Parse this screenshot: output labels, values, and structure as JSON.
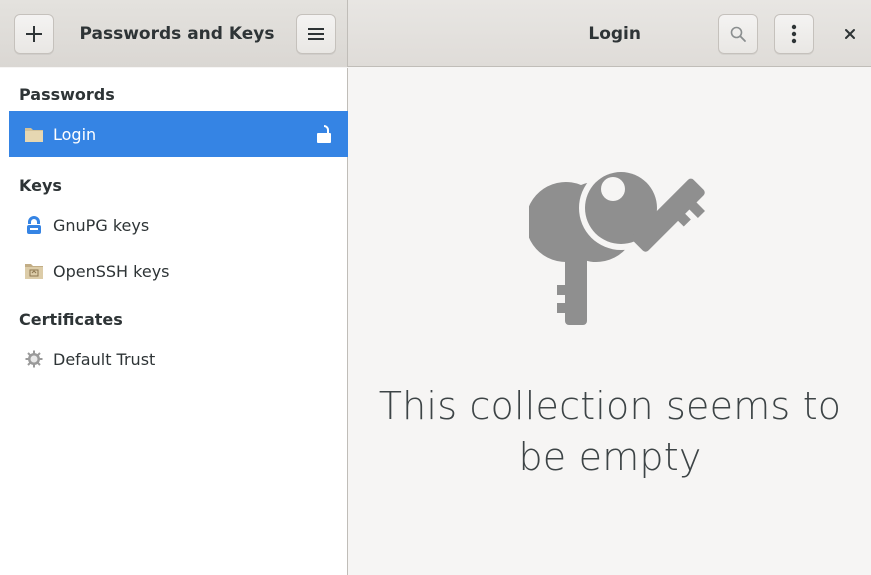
{
  "window": {
    "left_title": "Passwords and Keys",
    "right_title": "Login"
  },
  "header": {
    "add_icon": "plus-icon",
    "menu_icon": "hamburger-menu-icon",
    "search_icon": "search-icon",
    "more_icon": "vertical-ellipsis-icon",
    "close_icon": "close-icon"
  },
  "sidebar": {
    "sections": [
      {
        "heading": "Passwords",
        "items": [
          {
            "label": "Login",
            "icon": "folder-icon",
            "selected": true,
            "status_icon": "unlocked-padlock-icon"
          }
        ]
      },
      {
        "heading": "Keys",
        "items": [
          {
            "label": "GnuPG keys",
            "icon": "gnupg-icon",
            "selected": false
          },
          {
            "label": "OpenSSH keys",
            "icon": "ssh-folder-icon",
            "selected": false
          }
        ]
      },
      {
        "heading": "Certificates",
        "items": [
          {
            "label": "Default Trust",
            "icon": "gear-icon",
            "selected": false
          }
        ]
      }
    ]
  },
  "main": {
    "illustration": "keys-icon",
    "empty_message": "This collection seems to be empty"
  },
  "colors": {
    "accent": "#3584e4",
    "sidebar_bg": "#ffffff",
    "content_bg": "#f6f5f4",
    "illustration": "#8f8f8f"
  }
}
